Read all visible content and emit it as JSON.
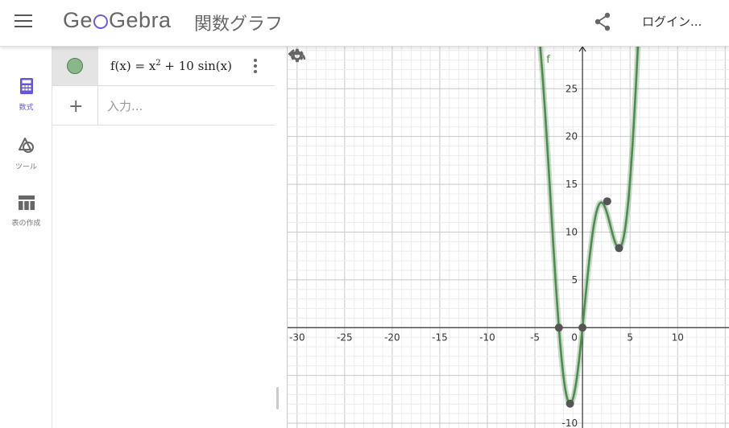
{
  "header": {
    "logo": "GeoGebra",
    "logo_parts": [
      "Ge",
      "Gebra"
    ],
    "title": "関数グラフ",
    "login_label": "ログイン..."
  },
  "toolbar": {
    "items": [
      {
        "label": "数式",
        "icon": "calculator-icon",
        "active": true
      },
      {
        "label": "ツール",
        "icon": "shapes-icon",
        "active": false
      },
      {
        "label": "表の作成",
        "icon": "table-icon",
        "active": false
      }
    ]
  },
  "algebra": {
    "entries": [
      {
        "formula_prefix": "f(x)  =  x",
        "exponent": "2",
        "formula_suffix": " + 10  sin(x)",
        "color": "#4f8a50"
      }
    ],
    "input_placeholder": "入力..."
  },
  "graphics": {
    "function_label": "f",
    "curve_color": "#4f8a50",
    "point_color": "#555555",
    "x_range": [
      -31,
      15.4
    ],
    "y_range": [
      -10.5,
      29.4
    ],
    "x_ticks": [
      "-30",
      "-25",
      "-20",
      "-15",
      "-10",
      "-5",
      "0",
      "5",
      "10"
    ],
    "y_ticks": [
      "-10",
      "5",
      "10",
      "15",
      "20",
      "25"
    ],
    "special_points": [
      {
        "name": "root-negative",
        "x": -2.48,
        "y": 0
      },
      {
        "name": "root-origin",
        "x": 0,
        "y": 0
      },
      {
        "name": "local-min-global",
        "x": -1.31,
        "y": -7.95
      },
      {
        "name": "local-max",
        "x": 2.6,
        "y": 13.22
      },
      {
        "name": "local-min",
        "x": 3.84,
        "y": 8.32
      }
    ]
  }
}
